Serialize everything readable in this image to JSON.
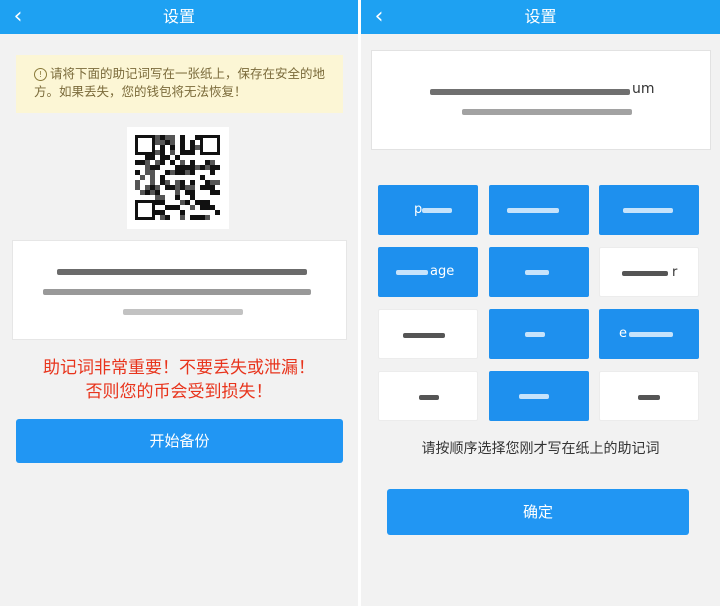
{
  "left": {
    "header": {
      "title": "设置",
      "back_icon": "chevron-left-icon"
    },
    "warning": {
      "icon": "info-circle-icon",
      "text": "请将下面的助记词写在一张纸上，保存在安全的地方。如果丢失，您的钱包将无法恢复！"
    },
    "qr_icon": "qr-code",
    "mnemonic_hidden": true,
    "important_line1": "助记词非常重要！不要丢失或泄漏！",
    "important_line2": "否则您的币会受到损失！",
    "start_button": "开始备份"
  },
  "right": {
    "header": {
      "title": "设置",
      "back_icon": "chevron-left-icon"
    },
    "selected_words_tail": "um",
    "words": [
      {
        "text": "p",
        "selected": true
      },
      {
        "text": "",
        "selected": true
      },
      {
        "text": "",
        "selected": true
      },
      {
        "text": "age",
        "selected": true
      },
      {
        "text": "",
        "selected": true
      },
      {
        "text": "r",
        "selected": false
      },
      {
        "text": "",
        "selected": false
      },
      {
        "text": "",
        "selected": true
      },
      {
        "text": "e",
        "selected": true
      },
      {
        "text": "",
        "selected": false
      },
      {
        "text": "",
        "selected": true
      },
      {
        "text": "",
        "selected": false
      }
    ],
    "instruction": "请按顺序选择您刚才写在纸上的助记词",
    "confirm_button": "确定"
  },
  "colors": {
    "header": "#1ea1f2",
    "button": "#2196f3",
    "warning_bg": "#fcf6d5",
    "important_text": "#e8341c"
  }
}
